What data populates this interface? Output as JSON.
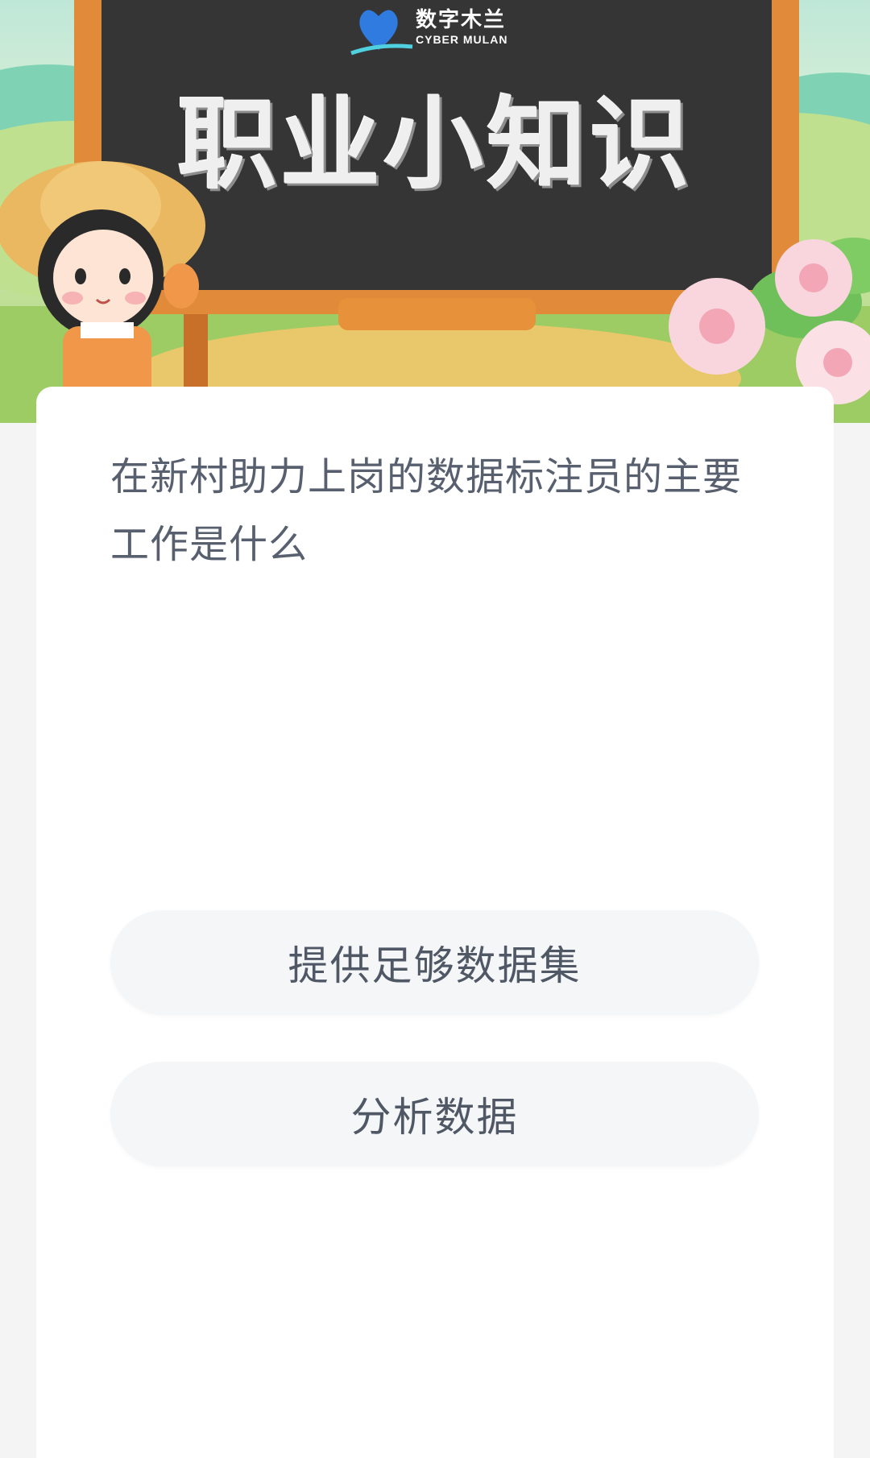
{
  "banner": {
    "logo": {
      "name_cn": "数字木兰",
      "name_en": "CYBER MULAN"
    },
    "title": "职业小知识"
  },
  "quiz": {
    "question": "在新村助力上岗的数据标注员的主要工作是什么",
    "options": [
      {
        "label": "提供足够数据集"
      },
      {
        "label": "分析数据"
      }
    ]
  },
  "colors": {
    "board": "#353535",
    "board_frame": "#e08a3a",
    "question_text": "#58606f",
    "option_bg": "#f5f6f8",
    "option_text": "#505866"
  }
}
